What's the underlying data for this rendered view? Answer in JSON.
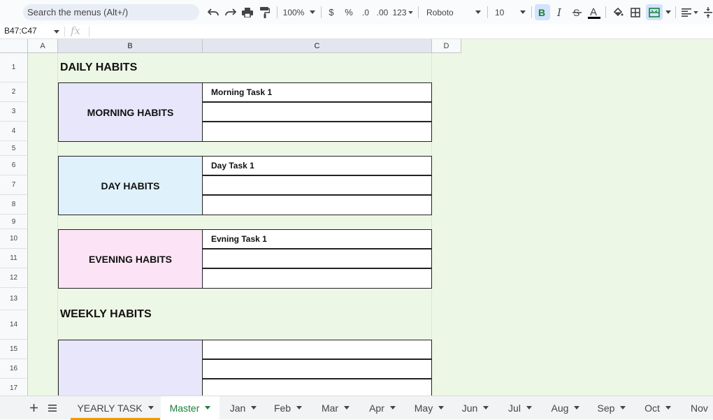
{
  "toolbar": {
    "search_placeholder": "Search the menus (Alt+/)",
    "zoom": "100%",
    "currency": "$",
    "percent": "%",
    "decrease_decimal": ".0",
    "increase_decimal": ".00",
    "number_format": "123",
    "font": "Roboto",
    "font_size": "10"
  },
  "formula_bar": {
    "name_box": "B47:C47",
    "fx": "fx"
  },
  "columns": [
    "A",
    "B",
    "C",
    "D"
  ],
  "rows": [
    "1",
    "2",
    "3",
    "4",
    "5",
    "6",
    "7",
    "8",
    "9",
    "10",
    "11",
    "12",
    "13",
    "14",
    "15",
    "16",
    "17"
  ],
  "sheet": {
    "daily_heading": "DAILY HABITS",
    "weekly_heading": "WEEKLY HABITS",
    "morning_label": "MORNING HABITS",
    "day_label": "DAY HABITS",
    "evening_label": "EVENING HABITS",
    "morning_task": "Morning Task 1",
    "day_task": "Day Task 1",
    "evening_task": "Evning Task 1"
  },
  "tabs": [
    "YEARLY TASK",
    "Master",
    "Jan",
    "Feb",
    "Mar",
    "Apr",
    "May",
    "Jun",
    "Jul",
    "Aug",
    "Sep",
    "Oct",
    "Nov"
  ],
  "colors": {
    "morning_fill": "#e8e6fb",
    "day_fill": "#dff2fc",
    "evening_fill": "#fce4f6",
    "background": "#edf7e5",
    "active_tab": "#188038",
    "tab_underline": "#f29900"
  }
}
